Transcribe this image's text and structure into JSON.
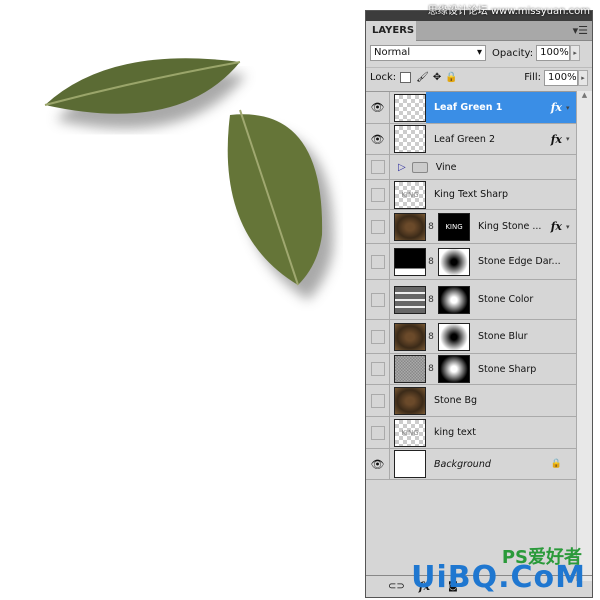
{
  "watermarks": {
    "top": "思缘设计论坛 www.missyuan.com",
    "ps": "PS爱好者",
    "bottom": "UiBQ.CoM"
  },
  "panel": {
    "tab": "LAYERS",
    "blend_mode": "Normal",
    "opacity_label": "Opacity:",
    "opacity": "100%",
    "lock_label": "Lock:",
    "fill_label": "Fill:",
    "fill": "100%",
    "selected_color": "#3a8ee6",
    "layers": [
      {
        "name": "Leaf Green 1",
        "visible": true,
        "selected": true,
        "fx": "fx",
        "thumb": "checker"
      },
      {
        "name": "Leaf Green 2",
        "visible": true,
        "fx": "fx",
        "thumb": "checker"
      },
      {
        "name": "Vine",
        "visible": false,
        "group": true
      },
      {
        "name": "King Text Sharp",
        "visible": false,
        "thumb": "checker",
        "thumb_text": "KING"
      },
      {
        "name": "King Stone ...",
        "visible": false,
        "fx": "fx",
        "thumb": "stone",
        "mask": "black",
        "mask_text": "KING"
      },
      {
        "name": "Stone Edge Dar...",
        "visible": false,
        "thumb": "levels",
        "mask": "mdark"
      },
      {
        "name": "Stone Color",
        "visible": false,
        "thumb": "grad",
        "mask": "mlight"
      },
      {
        "name": "Stone Blur",
        "visible": false,
        "thumb": "stone",
        "mask": "mdark"
      },
      {
        "name": "Stone Sharp",
        "visible": false,
        "thumb": "gray",
        "mask": "mlight"
      },
      {
        "name": "Stone Bg",
        "visible": false,
        "thumb": "stone"
      },
      {
        "name": "king text",
        "visible": false,
        "thumb": "checker",
        "thumb_text": "KING"
      },
      {
        "name": "Background",
        "visible": true,
        "thumb": "white",
        "locked": true,
        "italic": true
      }
    ],
    "bottom_icons": [
      "link-icon",
      "fx-icon",
      "mask-icon"
    ],
    "fx_glyph": "fx"
  }
}
